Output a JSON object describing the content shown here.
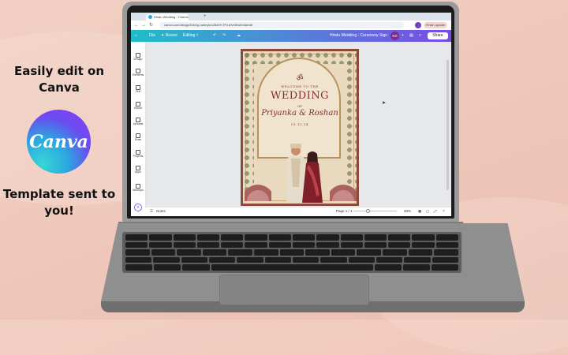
{
  "promo": {
    "headline": "Easily edit on Canva",
    "logo_text": "Canva",
    "footer": "Template sent to you!"
  },
  "browser": {
    "tab_title": "Hindu Wedding - Ceremony Si",
    "url": "canva.com/design/DAGg-na0eyk/o28AYKTPz1/fvhiEwIhhAfedit",
    "finish_label": "Finish update"
  },
  "toolbar": {
    "file": "File",
    "resize": "✦ Resize",
    "editing": "Editing ˅",
    "doc_title": "Hindu Wedding - Ceremony Sign",
    "avatar": "KD",
    "share": "Share"
  },
  "sidebar": {
    "items": [
      {
        "label": "Design",
        "icon": "design-icon"
      },
      {
        "label": "Elements",
        "icon": "elements-icon"
      },
      {
        "label": "Text",
        "icon": "text-icon"
      },
      {
        "label": "Brand",
        "icon": "brand-icon"
      },
      {
        "label": "Uploads",
        "icon": "uploads-icon"
      },
      {
        "label": "Draw",
        "icon": "draw-icon"
      },
      {
        "label": "Projects",
        "icon": "projects-icon"
      },
      {
        "label": "Apps",
        "icon": "apps-icon"
      },
      {
        "label": "Workups",
        "icon": "workups-icon"
      }
    ]
  },
  "design": {
    "om": "ॐ",
    "welcome": "WELCOME TO THE",
    "wedding": "WEDDING",
    "of": "OF",
    "names": "Priyanka & Roshan",
    "date": "01.12.24"
  },
  "bottombar": {
    "notes": "Notes",
    "page_indicator": "Page 1 / 1",
    "zoom": "33%"
  },
  "colors": {
    "accent_gradient_start": "#1fbcc9",
    "accent_gradient_end": "#7a4be3",
    "frame": "#8b4a3a",
    "title_text": "#8b2a2f"
  }
}
